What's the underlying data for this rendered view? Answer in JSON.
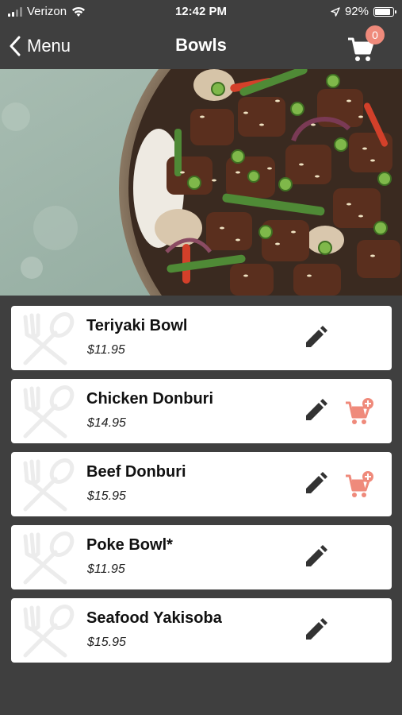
{
  "status_bar": {
    "carrier": "Verizon",
    "time": "12:42 PM",
    "battery": "92%"
  },
  "nav": {
    "back_label": "Menu",
    "title": "Bowls",
    "cart_count": "0"
  },
  "colors": {
    "background": "#3f3f3f",
    "card": "#ffffff",
    "accent": "#ef8a7b",
    "icon_dark": "#333333"
  },
  "items": [
    {
      "name": "Teriyaki Bowl",
      "price": "$11.95",
      "add_to_cart": false
    },
    {
      "name": "Chicken Donburi",
      "price": "$14.95",
      "add_to_cart": true
    },
    {
      "name": "Beef Donburi",
      "price": "$15.95",
      "add_to_cart": true
    },
    {
      "name": "Poke Bowl*",
      "price": "$11.95",
      "add_to_cart": false
    },
    {
      "name": "Seafood Yakisoba",
      "price": "$15.95",
      "add_to_cart": false
    }
  ],
  "icons": {
    "back": "chevron-left-icon",
    "cart": "cart-icon",
    "edit": "pencil-icon",
    "add_to_cart": "cart-plus-icon",
    "thumb": "fork-spoon-icon"
  }
}
